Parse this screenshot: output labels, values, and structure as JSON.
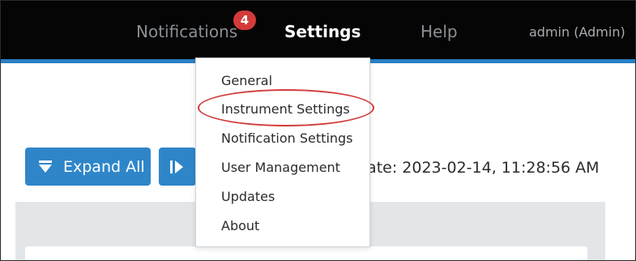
{
  "nav": {
    "notifications_label": "Notifications",
    "notifications_count": "4",
    "settings_label": "Settings",
    "help_label": "Help",
    "user_label": "admin (Admin)"
  },
  "settings_menu": {
    "items": [
      {
        "label": "General"
      },
      {
        "label": "Instrument Settings",
        "highlighted": true
      },
      {
        "label": "Notification Settings"
      },
      {
        "label": "User Management"
      },
      {
        "label": "Updates"
      },
      {
        "label": "About"
      }
    ]
  },
  "toolbar": {
    "expand_all_label": "Expand All",
    "expand_icon": "triangle-down-icon",
    "collapse_icon": "bar-triangle-icon"
  },
  "status": {
    "update_date_text": "date: 2023-02-14, 11:28:56 AM"
  },
  "colors": {
    "topbar": "#050505",
    "accent": "#2a7fc4",
    "button": "#2e86c9",
    "badge": "#d43a3a",
    "highlight": "#d23b3b",
    "panel": "#e2e6e9"
  }
}
